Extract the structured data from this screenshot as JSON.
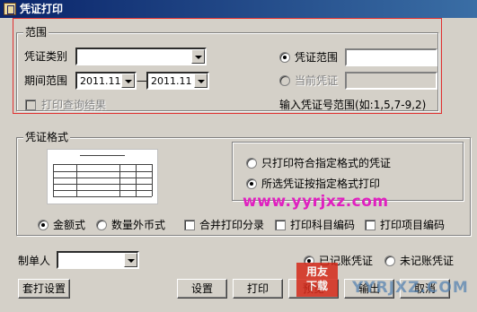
{
  "window": {
    "title": "凭证打印"
  },
  "range": {
    "group_label": "范围",
    "voucher_type_label": "凭证类别",
    "voucher_type_value": "",
    "period_label": "期间范围",
    "period_from": "2011.11",
    "period_sep": "—",
    "period_to": "2011.11",
    "print_query_label": "打印查询结果",
    "voucher_range_label": "凭证范围",
    "voucher_range_value": "",
    "current_voucher_label": "当前凭证",
    "range_hint": "输入凭证号范围(如:1,5,7-9,2)"
  },
  "format": {
    "group_label": "凭证格式",
    "option_matching": "只打印符合指定格式的凭证",
    "option_all": "所选凭证按指定格式打印",
    "amount_label": "金额式",
    "quantity_label": "数量外币式",
    "merge_label": "合并打印分录",
    "subject_code_label": "打印科目编码",
    "item_code_label": "打印项目编码"
  },
  "maker": {
    "label": "制单人",
    "value": "",
    "posted_label": "已记账凭证",
    "unposted_label": "未记账凭证"
  },
  "buttons": {
    "template_setup": "套打设置",
    "setup": "设置",
    "print": "打印",
    "preview": "预览",
    "output": "输出",
    "cancel": "取消"
  },
  "watermarks": {
    "url": "www.yyrjxz.com",
    "logo_line1": "用友",
    "logo_line2": "下载",
    "brand": "YYRJXZ.COM"
  }
}
